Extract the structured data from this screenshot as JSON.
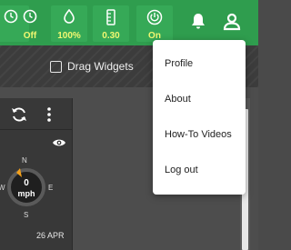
{
  "status_bar": {
    "stats": [
      {
        "icon": "clock-icon",
        "value": "Off"
      },
      {
        "icon": "water-drop-icon",
        "value": "100%"
      },
      {
        "icon": "gauge-icon",
        "value": "0.30"
      },
      {
        "icon": "power-icon",
        "value": "On"
      }
    ],
    "bell_icon": "bell-icon",
    "user_icon": "user-icon"
  },
  "toolbar": {
    "drag_widgets_label": "Drag Widgets"
  },
  "widget": {
    "compass": {
      "n": "N",
      "e": "E",
      "s": "S",
      "w": "W"
    },
    "speed_value": "0",
    "speed_unit": "mph",
    "date": "26 APR"
  },
  "user_menu": {
    "items": [
      "Profile",
      "About",
      "How-To Videos",
      "Log out"
    ]
  },
  "colors": {
    "status_green": "#2f9d4e",
    "stat_value_yellow": "#f1f871",
    "compass_needle": "#f3a01b"
  }
}
